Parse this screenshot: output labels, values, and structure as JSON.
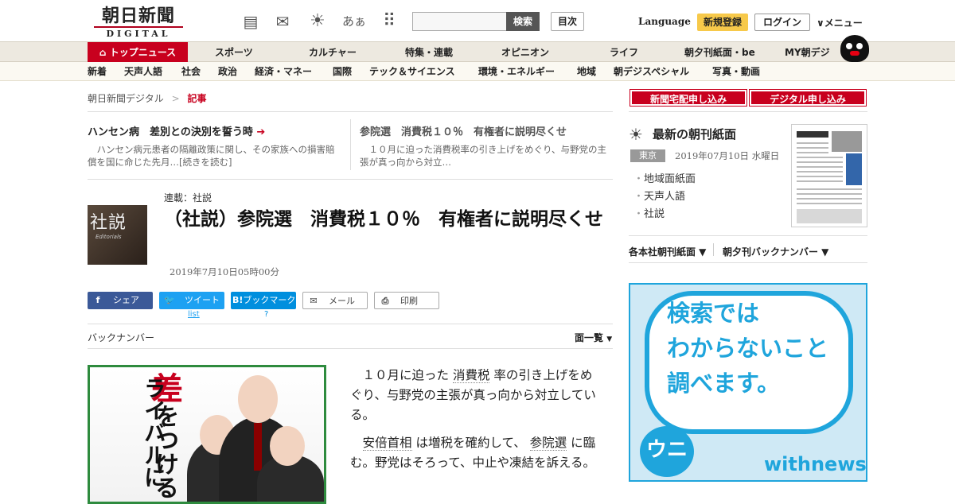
{
  "header": {
    "logo_jp": "朝日新聞",
    "logo_en": "DIGITAL",
    "search_button": "検索",
    "toc_button": "目次",
    "language": "Language",
    "register": "新規登録",
    "login": "ログイン",
    "menu": "∨メニュー"
  },
  "icons": [
    "newspaper-icon",
    "mail-icon",
    "weather-icon",
    "font-size-icon",
    "grid-icon"
  ],
  "font_size_label": "あぁ",
  "nav_primary": [
    "トップニュース",
    "スポーツ",
    "カルチャー",
    "特集・連載",
    "オピニオン",
    "ライフ",
    "朝夕刊紙面・be",
    "MY朝デジ"
  ],
  "nav_secondary": [
    "新着",
    "天声人語",
    "社会",
    "政治",
    "経済・マネー",
    "国際",
    "テック＆サイエンス",
    "環境・エネルギー",
    "地域",
    "朝デジスペシャル",
    "写真・動画"
  ],
  "breadcrumb": {
    "home": "朝日新聞デジタル",
    "sep": ">",
    "current": "記事"
  },
  "related": [
    {
      "title": "ハンセン病　差別との決別を誓う時",
      "desc": "ハンセン病元患者の隔離政策に関し、その家族への損害賠償を国に命じた先月…[続きを読む]"
    },
    {
      "title": "参院選　消費税１０％　有権者に説明尽くせ",
      "desc": "１０月に迫った消費税率の引き上げをめぐり、与野党の主張が真っ向から対立…"
    }
  ],
  "article": {
    "series": "連載：社説",
    "image_title": "社説",
    "image_sub": "Editorials",
    "headline": "（社説）参院選　消費税１０％　有権者に説明尽くせ",
    "date": "2019年7月10日05時00分",
    "share": {
      "facebook": "シェア",
      "twitter": "ツイート",
      "twitter_sub": "list",
      "hatena": "ブックマーク",
      "hatena_sub": "?",
      "mail": "メール",
      "print": "印刷"
    },
    "back_number": "バックナンバー",
    "list_dir": "面一覧",
    "body": [
      {
        "a": "１０月に迫った ",
        "kw": "消費税",
        "b": " 率の引き上げをめぐり、与野党の主張が真っ向から対立している。"
      },
      {
        "a": "",
        "kw": "安倍首相",
        "b": " は増税を確約して、 ",
        "kw2": "参院選",
        "c": " に臨む。野党はそろって、中止や凍結を訴える。"
      }
    ]
  },
  "ad": {
    "sa": "差",
    "wo": "をつける",
    "v": "ライバルに"
  },
  "sidebar": {
    "btn1": "新聞宅配申し込み",
    "btn2": "デジタル申し込み",
    "paper_title": "最新の朝刊紙面",
    "edition": "東京",
    "paper_date": "2019年07月10日 水曜日",
    "links": [
      "地域面紙面",
      "天声人語",
      "社説"
    ],
    "dd1": "各本社朝刊紙面 ▼",
    "dd2": "朝夕刊バックナンバー ▼",
    "withnews_text": [
      "検索では",
      "わからないこと",
      "調べます。"
    ],
    "withnews_logo": "withnews",
    "withnews_mark": "ウニュ"
  },
  "colors": {
    "brand": "#c8001e",
    "register": "#f7c94a",
    "withnews": "#1fa5dc"
  }
}
